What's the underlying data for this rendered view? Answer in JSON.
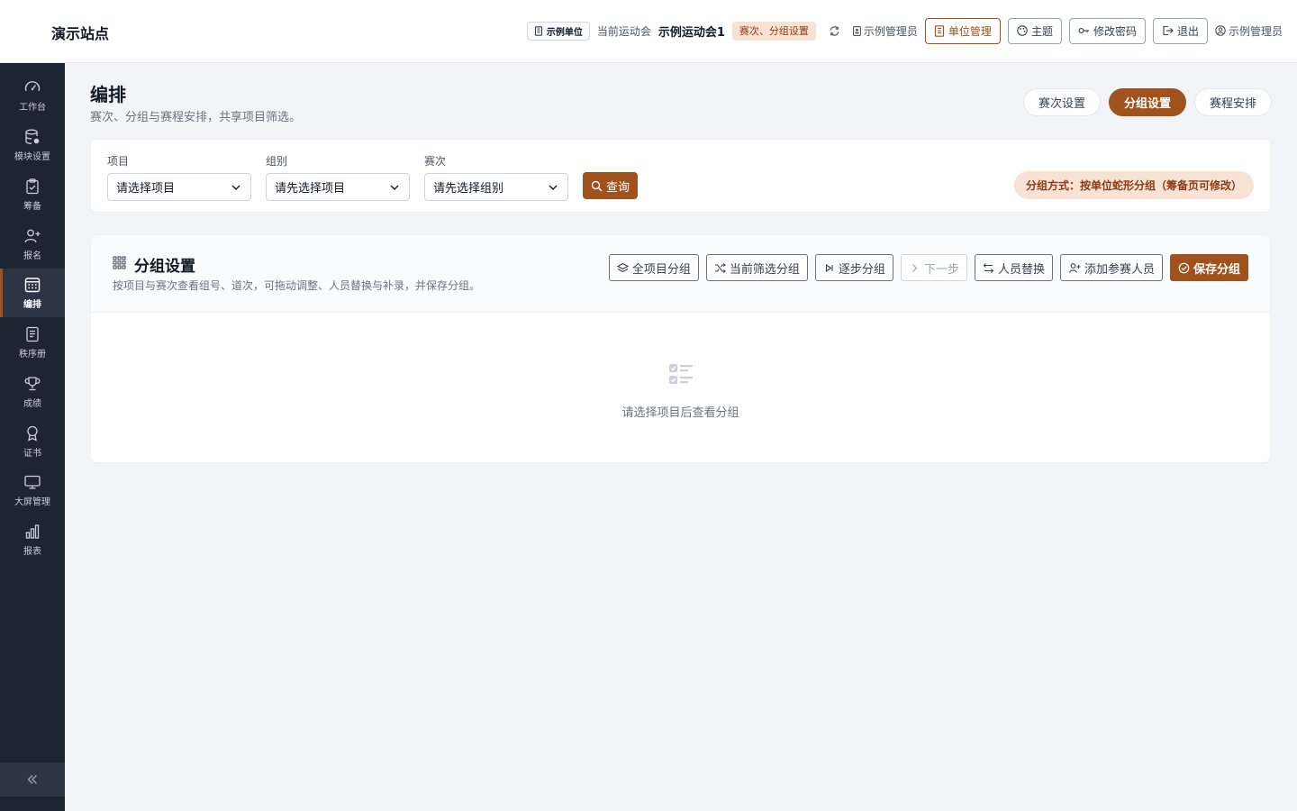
{
  "site": {
    "name": "演示站点"
  },
  "topbar": {
    "unit_chip": "示例单位",
    "current_meet_label": "当前运动会",
    "current_meet_name": "示例运动会1",
    "context_tag": "赛次、分组设置",
    "user_role": "示例管理员",
    "unit_manage": "单位管理",
    "theme": "主题",
    "change_password": "修改密码",
    "logout": "退出",
    "username": "示例管理员"
  },
  "sidebar": {
    "items": [
      {
        "label": "工作台",
        "icon": "gauge-icon"
      },
      {
        "label": "模块设置",
        "icon": "database-icon"
      },
      {
        "label": "筹备",
        "icon": "clipboard-icon"
      },
      {
        "label": "报名",
        "icon": "user-plus-icon"
      },
      {
        "label": "编排",
        "icon": "calendar-grid-icon",
        "active": true
      },
      {
        "label": "秩序册",
        "icon": "book-icon"
      },
      {
        "label": "成绩",
        "icon": "trophy-icon"
      },
      {
        "label": "证书",
        "icon": "award-icon"
      },
      {
        "label": "大屏管理",
        "icon": "monitor-icon"
      },
      {
        "label": "报表",
        "icon": "bar-chart-icon"
      }
    ],
    "collapse_icon": "chevrons-left-icon"
  },
  "page": {
    "title": "编排",
    "subtitle": "赛次、分组与赛程安排，共享项目筛选。",
    "tabs": [
      {
        "label": "赛次设置"
      },
      {
        "label": "分组设置",
        "active": true
      },
      {
        "label": "赛程安排"
      }
    ]
  },
  "filters": {
    "event": {
      "label": "项目",
      "value": "请选择项目"
    },
    "group": {
      "label": "组别",
      "value": "请先选择项目"
    },
    "round": {
      "label": "赛次",
      "value": "请先选择组别"
    },
    "query_label": "查询",
    "mode_text": "分组方式：按单位蛇形分组（筹备页可修改）"
  },
  "group_panel": {
    "title": "分组设置",
    "subtitle": "按项目与赛次查看组号、道次，可拖动调整、人员替换与补录，并保存分组。",
    "actions": {
      "all_events": "全项目分组",
      "current_filter": "当前筛选分组",
      "step": "逐步分组",
      "next": "下一步",
      "replace": "人员替换",
      "add_participant": "添加参赛人员",
      "save": "保存分组"
    },
    "empty_text": "请选择项目后查看分组"
  },
  "colors": {
    "accent": "#a0521c",
    "sidebar": "#1e2532",
    "accent_soft": "#f7e2d4"
  }
}
